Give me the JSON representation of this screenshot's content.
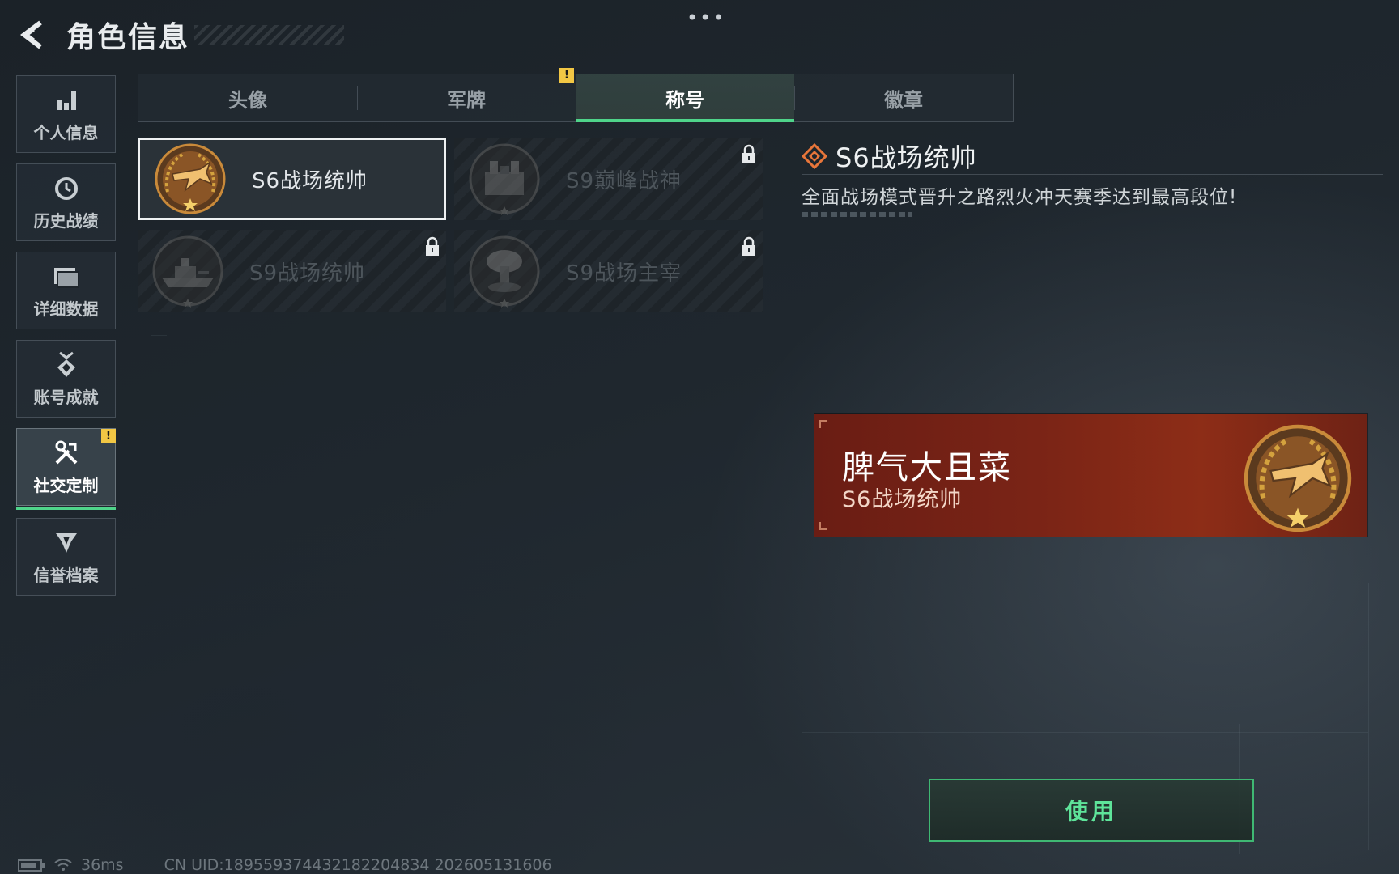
{
  "header": {
    "title": "角色信息",
    "more_icon": "more-dots-icon",
    "back_icon": "back-arrow-icon"
  },
  "sidebar": {
    "items": [
      {
        "label": "个人信息",
        "icon": "bar-chart-icon",
        "active": false
      },
      {
        "label": "历史战绩",
        "icon": "history-clock-icon",
        "active": false
      },
      {
        "label": "详细数据",
        "icon": "folder-icon",
        "active": false
      },
      {
        "label": "账号成就",
        "icon": "achievement-medal-icon",
        "active": false
      },
      {
        "label": "社交定制",
        "icon": "tools-icon",
        "active": true,
        "badge": "!"
      },
      {
        "label": "信誉档案",
        "icon": "credit-badge-icon",
        "active": false
      }
    ]
  },
  "tabs": [
    {
      "label": "头像",
      "active": false
    },
    {
      "label": "军牌",
      "active": false,
      "badge": "!"
    },
    {
      "label": "称号",
      "active": true
    },
    {
      "label": "徽章",
      "active": false
    }
  ],
  "titles": [
    {
      "name": "S6战场统帅",
      "emblem": "fighter-jet-emblem-icon",
      "locked": false,
      "selected": true
    },
    {
      "name": "S9巅峰战神",
      "emblem": "fortress-emblem-icon",
      "locked": true,
      "selected": false
    },
    {
      "name": "S9战场统帅",
      "emblem": "warship-emblem-icon",
      "locked": true,
      "selected": false
    },
    {
      "name": "S9战场主宰",
      "emblem": "mushroom-cloud-emblem-icon",
      "locked": true,
      "selected": false
    }
  ],
  "detail": {
    "name": "S6战场统帅",
    "description": "全面战场模式晋升之路烈火冲天赛季达到最高段位!",
    "icon": "diamond-rank-icon"
  },
  "preview": {
    "player_name": "脾气大且菜",
    "title": "S6战场统帅",
    "emblem": "fighter-jet-emblem-icon"
  },
  "actions": {
    "use_label": "使用"
  },
  "status_bar": {
    "ping": "36ms",
    "uid": "CN UID:1895593744321822048​34 202605131606"
  },
  "colors": {
    "accent": "#4fd48a",
    "badge": "#f2c744",
    "banner": "#7a2416",
    "emblem_gold": "#c9862f"
  }
}
